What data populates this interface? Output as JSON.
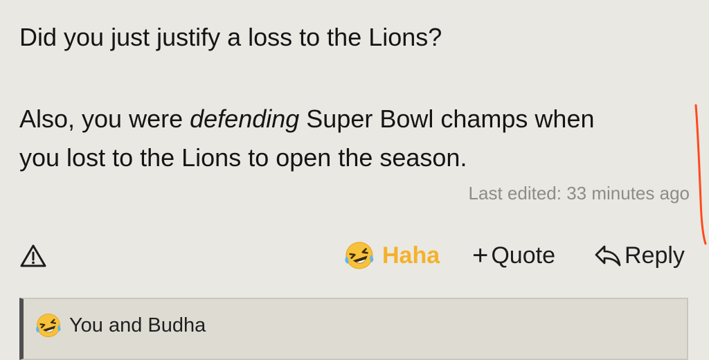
{
  "post": {
    "line1": "Did you just justify a loss to the Lions?",
    "line2_pre": "Also, you were ",
    "line2_em": "defending",
    "line2_post": " Super Bowl champs when",
    "line3": "you lost to the Lions to open the season.",
    "last_edited": "Last edited: 33 minutes ago"
  },
  "actions": {
    "report_icon": "warning-triangle-icon",
    "haha_label": "Haha",
    "haha_icon": "laughing-tears-emoji-icon",
    "quote_label": "Quote",
    "quote_prefix": "+",
    "reply_label": "Reply",
    "reply_icon": "reply-arrow-icon",
    "haha_color": "#f5b12a"
  },
  "reactions": {
    "summary": "You and Budha",
    "icon": "laughing-tears-emoji-icon"
  },
  "colors": {
    "background": "#e9e8e3",
    "scroll_mark": "#ff4a1c",
    "reaction_bar_bg": "#dedcd2",
    "reaction_bar_border": "#4f4f4f"
  }
}
